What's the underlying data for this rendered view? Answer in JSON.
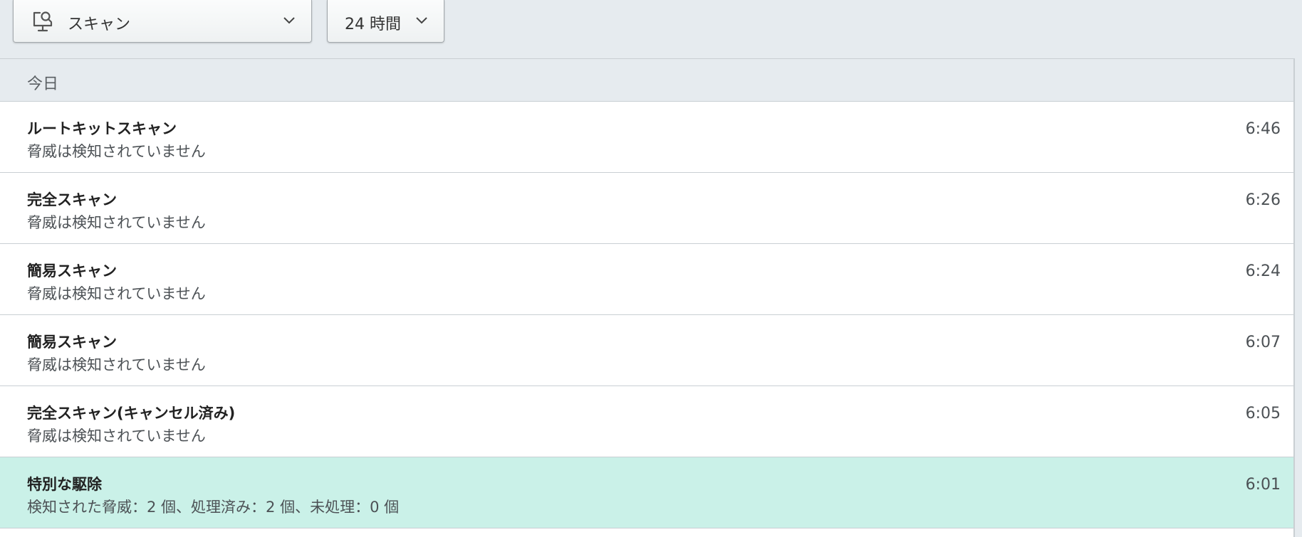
{
  "filters": {
    "scan_type": {
      "label": "スキャン",
      "icon": "monitor-search-icon"
    },
    "time_range": {
      "label": "24 時間"
    }
  },
  "history": {
    "group_label": "今日",
    "rows": [
      {
        "title": "ルートキットスキャン",
        "subtitle": "脅威は検知されていません",
        "time": "6:46",
        "highlighted": false
      },
      {
        "title": "完全スキャン",
        "subtitle": "脅威は検知されていません",
        "time": "6:26",
        "highlighted": false
      },
      {
        "title": "簡易スキャン",
        "subtitle": "脅威は検知されていません",
        "time": "6:24",
        "highlighted": false
      },
      {
        "title": "簡易スキャン",
        "subtitle": "脅威は検知されていません",
        "time": "6:07",
        "highlighted": false
      },
      {
        "title": "完全スキャン(キャンセル済み)",
        "subtitle": "脅威は検知されていません",
        "time": "6:05",
        "highlighted": false
      },
      {
        "title": "特別な駆除",
        "subtitle": "検知された脅威：2 個、処理済み：2 個、未処理：0 個",
        "time": "6:01",
        "highlighted": true
      }
    ]
  },
  "colors": {
    "background": "#e6ebef",
    "highlight": "#caf1e8",
    "border": "#c9cfd3"
  }
}
